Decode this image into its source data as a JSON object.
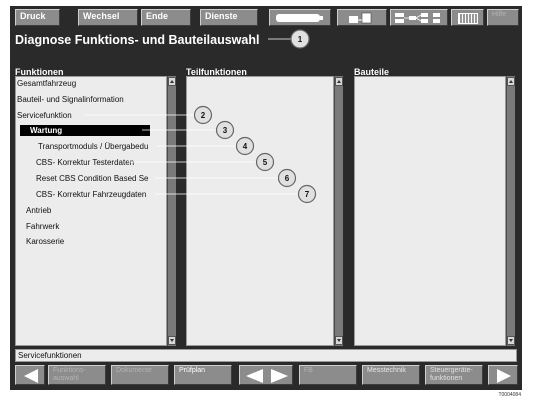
{
  "toolbar": {
    "print_label": "Druck",
    "change_label": "Wechsel",
    "end_label": "Ende",
    "services_label": "Dienste",
    "help_label": "Hilfe"
  },
  "page": {
    "title": "Diagnose Funktions- und Bauteilauswahl"
  },
  "columns": {
    "functions": "Funktionen",
    "subfunctions": "Teilfunktionen",
    "components": "Bauteile"
  },
  "functions_list": [
    "Gesamtfahrzeug",
    "Bauteil- und Signalinformation",
    "Servicefunktion",
    "Wartung",
    "Transportmoduls / Übergabedu",
    "CBS- Korrektur Testerdaten",
    "Reset CBS Condition Based Se",
    "CBS- Korrektur Fahrzeugdaten",
    "Antrieb",
    "Fahrwerk",
    "Karosserie"
  ],
  "status_text": "Servicefunktionen",
  "bottom": {
    "function_select": "Funktions- auswahl",
    "documents": "Dokumente",
    "test_plan": "Prüfplan",
    "fb": "FB",
    "measure": "Messtechnik",
    "ecu_functions": "Steuergeräte- funktionen"
  },
  "callouts": [
    "1",
    "2",
    "3",
    "4",
    "5",
    "6",
    "7"
  ],
  "image_code": "T0004084"
}
